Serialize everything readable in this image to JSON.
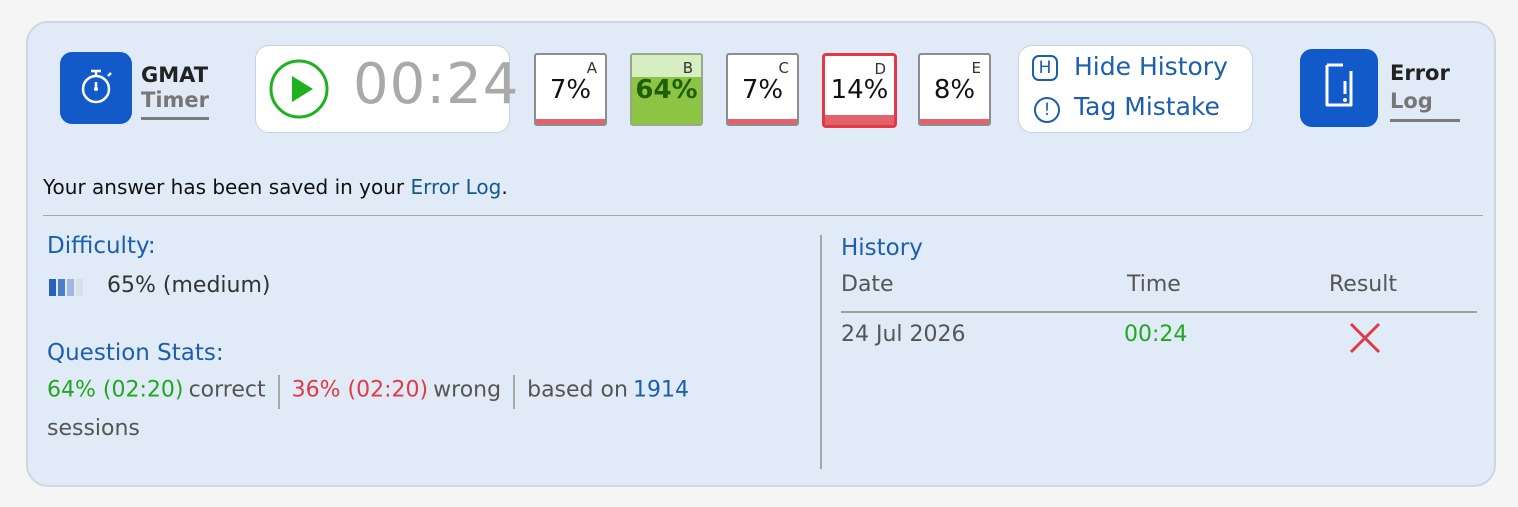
{
  "toolbar": {
    "timer_app": {
      "title": "GMAT",
      "subtitle": "Timer",
      "icon": "stopwatch-icon",
      "color": "#1259c9"
    },
    "timer": {
      "value": "00:24",
      "play_icon": "play-icon",
      "play_color": "#1fb21f"
    },
    "answers": [
      {
        "letter": "A",
        "percent": "7%"
      },
      {
        "letter": "B",
        "percent": "64%",
        "correct": true
      },
      {
        "letter": "C",
        "percent": "7%"
      },
      {
        "letter": "D",
        "percent": "14%",
        "selected": true
      },
      {
        "letter": "E",
        "percent": "8%"
      }
    ],
    "history_toggle": {
      "key": "H",
      "label": "Hide History"
    },
    "tag_mistake": {
      "key": "!",
      "label": "Tag Mistake"
    },
    "error_log_app": {
      "title": "Error",
      "subtitle": "Log",
      "icon": "error-log-icon",
      "color": "#1259c9"
    }
  },
  "message": {
    "text": "Your answer has been saved in your ",
    "link": "Error Log",
    "end": "."
  },
  "difficulty": {
    "heading": "Difficulty:",
    "value": "65% (medium)",
    "icon": "difficulty-bars-icon"
  },
  "question_stats": {
    "heading": "Question Stats:",
    "correct_value": "64% (02:20)",
    "correct_label": "correct",
    "wrong_value": "36% (02:20)",
    "wrong_label": "wrong",
    "based_label": "based on",
    "sessions_count": "1914",
    "sessions_label": "sessions"
  },
  "history": {
    "heading": "History",
    "columns": [
      "Date",
      "Time",
      "Result"
    ],
    "rows": [
      {
        "date": "24 Jul 2026",
        "time": "00:24",
        "result": "wrong",
        "result_icon": "x-icon"
      }
    ]
  },
  "colors": {
    "correct": "#21a821",
    "wrong": "#e23a45",
    "link": "#1b5fae",
    "panel_bg": "#e1eaf7"
  }
}
